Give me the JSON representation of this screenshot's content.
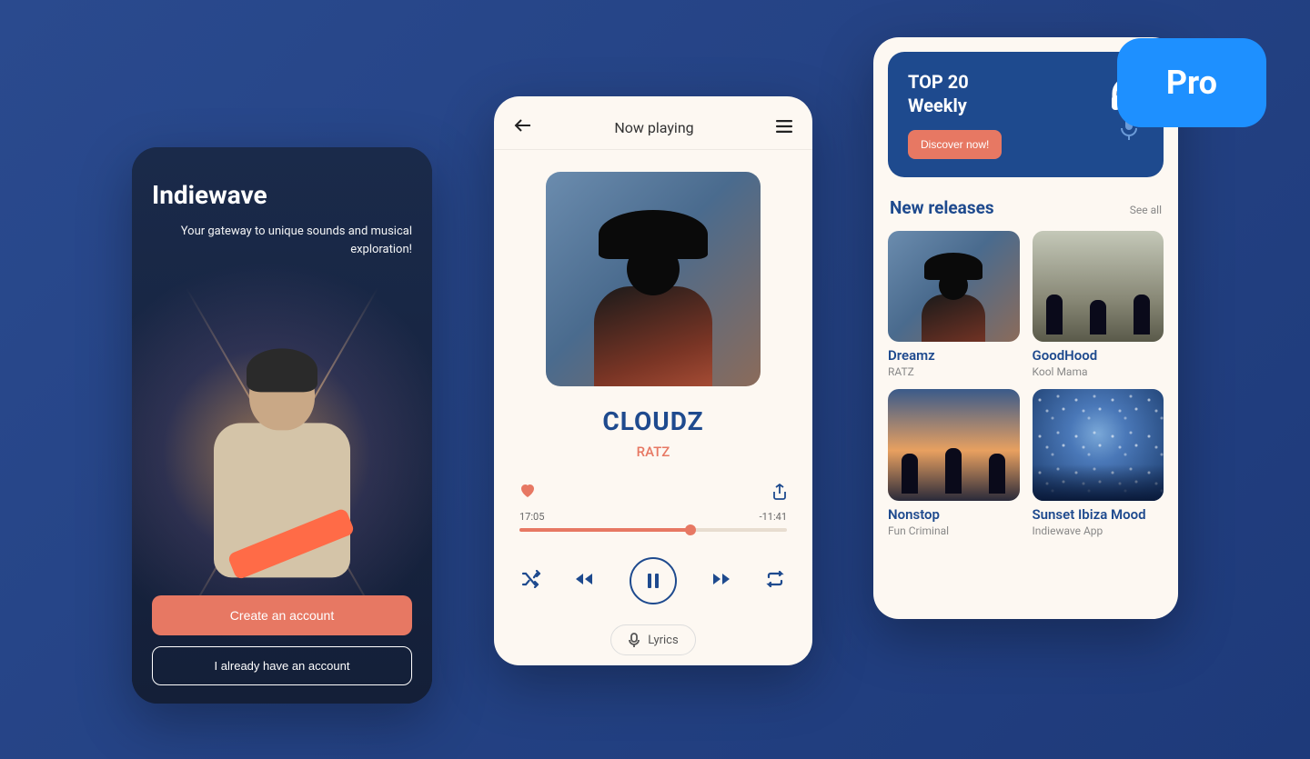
{
  "badge": {
    "label": "Pro"
  },
  "onboarding": {
    "app_name": "Indiewave",
    "tagline": "Your gateway to unique sounds and musical exploration!",
    "create_label": "Create an account",
    "signin_label": "I already have an account"
  },
  "player": {
    "header_title": "Now playing",
    "track_title": "CLOUDZ",
    "track_artist": "RATZ",
    "elapsed": "17:05",
    "remaining": "-11:41",
    "progress_percent": 64,
    "lyrics_label": "Lyrics"
  },
  "discover": {
    "top20": {
      "line1": "TOP 20",
      "line2": "Weekly",
      "cta": "Discover now!"
    },
    "section_title": "New releases",
    "see_all": "See all",
    "tiles": [
      {
        "title": "Dreamz",
        "artist": "RATZ"
      },
      {
        "title": "GoodHood",
        "artist": "Kool Mama"
      },
      {
        "title": "Nonstop",
        "artist": "Fun Criminal"
      },
      {
        "title": "Sunset Ibiza Mood",
        "artist": "Indiewave App"
      }
    ]
  }
}
